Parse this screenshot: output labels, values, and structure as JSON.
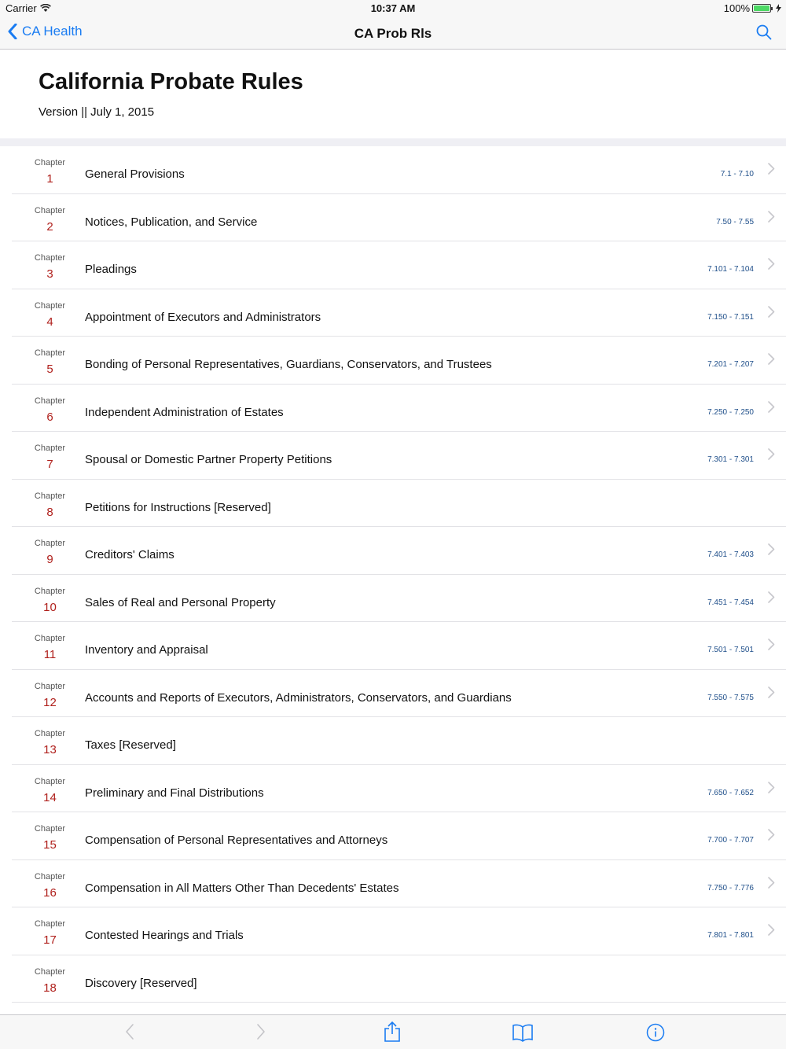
{
  "status": {
    "carrier": "Carrier",
    "time": "10:37 AM",
    "battery": "100%",
    "battery_level": 1.0
  },
  "nav": {
    "back_label": "CA Health",
    "title": "CA Prob Rls"
  },
  "header": {
    "title": "California Probate Rules",
    "subtitle": "Version || July 1, 2015"
  },
  "colors": {
    "accent": "#1a7cf2",
    "chapter_number": "#b0201c",
    "range": "#1f4f8a"
  },
  "chapters": [
    {
      "label": "Chapter",
      "number": "1",
      "title": "General Provisions",
      "range": "7.1 - 7.10"
    },
    {
      "label": "Chapter",
      "number": "2",
      "title": "Notices, Publication, and Service",
      "range": "7.50 - 7.55"
    },
    {
      "label": "Chapter",
      "number": "3",
      "title": "Pleadings",
      "range": "7.101 - 7.104"
    },
    {
      "label": "Chapter",
      "number": "4",
      "title": "Appointment of Executors and Administrators",
      "range": "7.150 - 7.151"
    },
    {
      "label": "Chapter",
      "number": "5",
      "title": "Bonding of Personal Representatives, Guardians, Conservators, and Trustees",
      "range": "7.201 - 7.207"
    },
    {
      "label": "Chapter",
      "number": "6",
      "title": "Independent Administration of Estates",
      "range": "7.250 - 7.250"
    },
    {
      "label": "Chapter",
      "number": "7",
      "title": "Spousal or Domestic Partner Property Petitions",
      "range": "7.301 - 7.301"
    },
    {
      "label": "Chapter",
      "number": "8",
      "title": "Petitions for Instructions [Reserved]",
      "range": ""
    },
    {
      "label": "Chapter",
      "number": "9",
      "title": "Creditors' Claims",
      "range": "7.401 - 7.403"
    },
    {
      "label": "Chapter",
      "number": "10",
      "title": "Sales of Real and Personal Property",
      "range": "7.451 - 7.454"
    },
    {
      "label": "Chapter",
      "number": "11",
      "title": "Inventory and Appraisal",
      "range": "7.501 - 7.501"
    },
    {
      "label": "Chapter",
      "number": "12",
      "title": "Accounts and Reports of Executors, Administrators, Conservators, and Guardians",
      "range": "7.550 - 7.575"
    },
    {
      "label": "Chapter",
      "number": "13",
      "title": "Taxes [Reserved]",
      "range": ""
    },
    {
      "label": "Chapter",
      "number": "14",
      "title": "Preliminary and Final Distributions",
      "range": "7.650 - 7.652"
    },
    {
      "label": "Chapter",
      "number": "15",
      "title": "Compensation of Personal Representatives and Attorneys",
      "range": "7.700 - 7.707"
    },
    {
      "label": "Chapter",
      "number": "16",
      "title": "Compensation in All Matters Other Than Decedents' Estates",
      "range": "7.750 - 7.776"
    },
    {
      "label": "Chapter",
      "number": "17",
      "title": "Contested Hearings and Trials",
      "range": "7.801 - 7.801"
    },
    {
      "label": "Chapter",
      "number": "18",
      "title": "Discovery [Reserved]",
      "range": ""
    }
  ],
  "toolbar": {
    "icons": [
      "back-arrow-icon",
      "forward-arrow-icon",
      "share-icon",
      "book-icon",
      "info-icon"
    ]
  }
}
